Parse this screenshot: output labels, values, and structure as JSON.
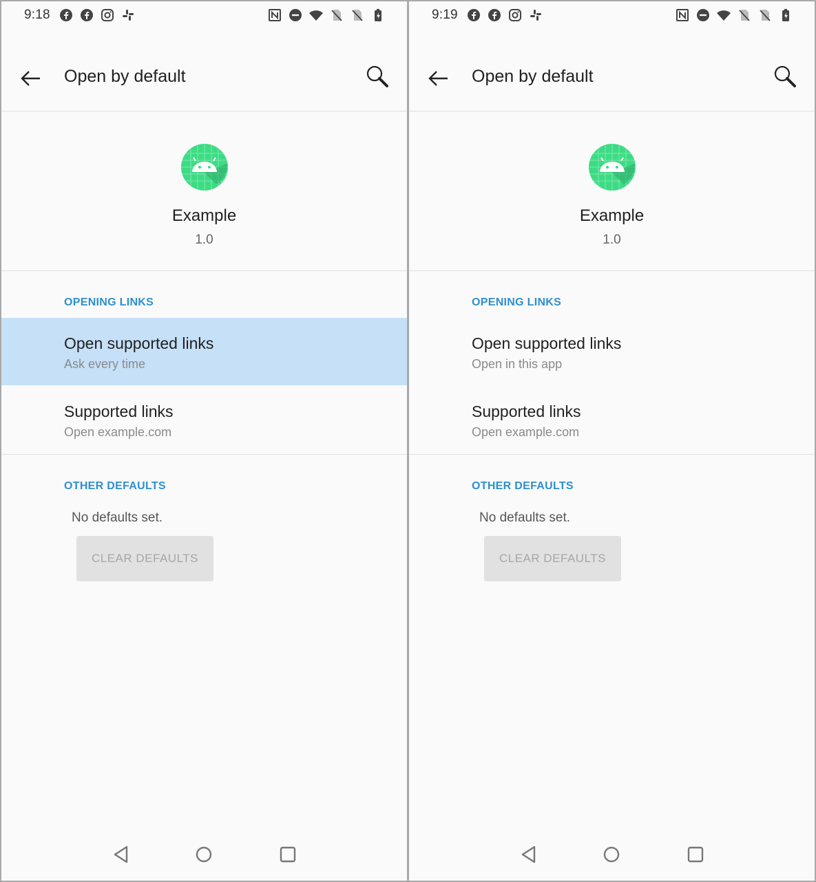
{
  "colors": {
    "accent": "#2e8fcf",
    "highlight": "#c5e0f7",
    "icon_green": "#3ddc84",
    "background": "#fafafa"
  },
  "screens": [
    {
      "status": {
        "time": "9:18",
        "left_icons": [
          "facebook-icon",
          "facebook-icon",
          "instagram-icon",
          "slack-icon"
        ],
        "right_icons": [
          "nfc-icon",
          "dnd-icon",
          "wifi-icon",
          "no-sim-icon",
          "no-sim-icon",
          "battery-icon"
        ]
      },
      "app_bar": {
        "title": "Open by default"
      },
      "app_info": {
        "name": "Example",
        "version": "1.0"
      },
      "opening_links": {
        "header": "OPENING LINKS",
        "open_supported": {
          "title": "Open supported links",
          "summary": "Ask every time",
          "highlighted": true
        },
        "supported_links": {
          "title": "Supported links",
          "summary": "Open example.com"
        }
      },
      "other_defaults": {
        "header": "OTHER DEFAULTS",
        "message": "No defaults set.",
        "button": "CLEAR DEFAULTS"
      }
    },
    {
      "status": {
        "time": "9:19",
        "left_icons": [
          "facebook-icon",
          "facebook-icon",
          "instagram-icon",
          "slack-icon"
        ],
        "right_icons": [
          "nfc-icon",
          "dnd-icon",
          "wifi-icon",
          "no-sim-icon",
          "no-sim-icon",
          "battery-icon"
        ]
      },
      "app_bar": {
        "title": "Open by default"
      },
      "app_info": {
        "name": "Example",
        "version": "1.0"
      },
      "opening_links": {
        "header": "OPENING LINKS",
        "open_supported": {
          "title": "Open supported links",
          "summary": "Open in this app",
          "highlighted": false
        },
        "supported_links": {
          "title": "Supported links",
          "summary": "Open example.com"
        }
      },
      "other_defaults": {
        "header": "OTHER DEFAULTS",
        "message": "No defaults set.",
        "button": "CLEAR DEFAULTS"
      }
    }
  ]
}
